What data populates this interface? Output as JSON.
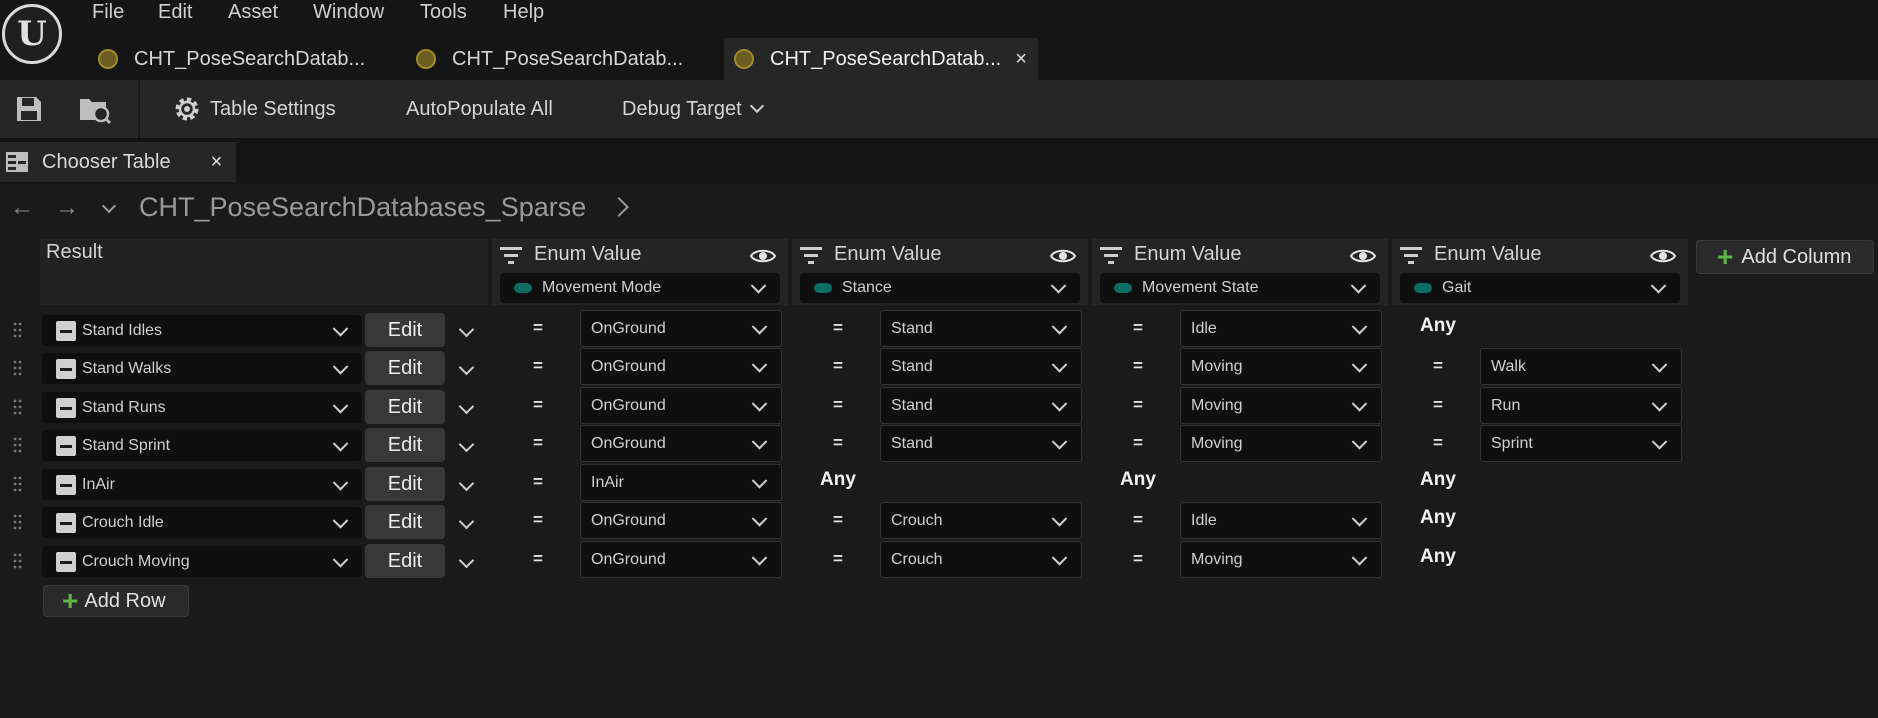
{
  "menu": [
    "File",
    "Edit",
    "Asset",
    "Window",
    "Tools",
    "Help"
  ],
  "doc_tabs": [
    {
      "label": "CHT_PoseSearchDatab..."
    },
    {
      "label": "CHT_PoseSearchDatab..."
    },
    {
      "label": "CHT_PoseSearchDatab...",
      "close": "×"
    }
  ],
  "toolbar": {
    "table_settings": "Table Settings",
    "autopopulate": "AutoPopulate All",
    "debug_target": "Debug Target"
  },
  "panel_tab": {
    "label": "Chooser Table",
    "close": "×"
  },
  "breadcrumb": {
    "path": "CHT_PoseSearchDatabases_Sparse"
  },
  "table": {
    "result_header": "Result",
    "columns": [
      {
        "title": "Enum Value",
        "enum": "Movement Mode"
      },
      {
        "title": "Enum Value",
        "enum": "Stance"
      },
      {
        "title": "Enum Value",
        "enum": "Movement State"
      },
      {
        "title": "Enum Value",
        "enum": "Gait"
      }
    ],
    "add_column": "Add Column",
    "edit_label": "Edit",
    "eq": "=",
    "any": "Any",
    "rows": [
      {
        "result": "Stand Idles",
        "c0": "OnGround",
        "c1": "Stand",
        "c2": "Idle",
        "c3": ""
      },
      {
        "result": "Stand Walks",
        "c0": "OnGround",
        "c1": "Stand",
        "c2": "Moving",
        "c3": "Walk"
      },
      {
        "result": "Stand Runs",
        "c0": "OnGround",
        "c1": "Stand",
        "c2": "Moving",
        "c3": "Run"
      },
      {
        "result": "Stand Sprint",
        "c0": "OnGround",
        "c1": "Stand",
        "c2": "Moving",
        "c3": "Sprint"
      },
      {
        "result": "InAir",
        "c0": "InAir",
        "c1": "",
        "c2": "",
        "c3": ""
      },
      {
        "result": "Crouch Idle",
        "c0": "OnGround",
        "c1": "Crouch",
        "c2": "Idle",
        "c3": ""
      },
      {
        "result": "Crouch Moving",
        "c0": "OnGround",
        "c1": "Crouch",
        "c2": "Moving",
        "c3": ""
      }
    ],
    "add_row": "Add Row"
  }
}
